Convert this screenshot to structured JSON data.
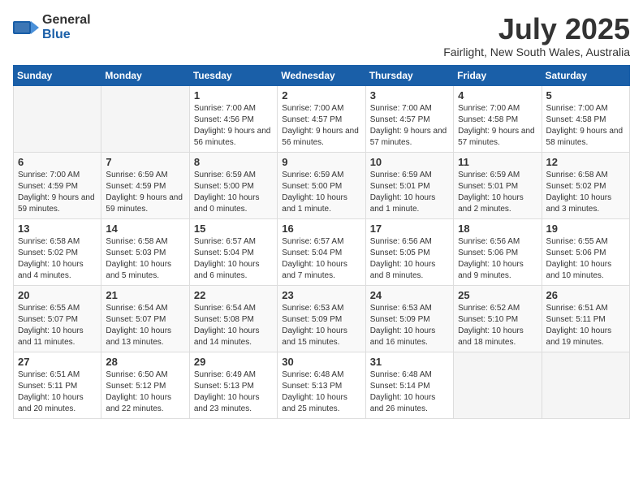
{
  "header": {
    "logo_general": "General",
    "logo_blue": "Blue",
    "month_title": "July 2025",
    "location": "Fairlight, New South Wales, Australia"
  },
  "days_of_week": [
    "Sunday",
    "Monday",
    "Tuesday",
    "Wednesday",
    "Thursday",
    "Friday",
    "Saturday"
  ],
  "weeks": [
    [
      {
        "day": "",
        "info": ""
      },
      {
        "day": "",
        "info": ""
      },
      {
        "day": "1",
        "info": "Sunrise: 7:00 AM\nSunset: 4:56 PM\nDaylight: 9 hours and 56 minutes."
      },
      {
        "day": "2",
        "info": "Sunrise: 7:00 AM\nSunset: 4:57 PM\nDaylight: 9 hours and 56 minutes."
      },
      {
        "day": "3",
        "info": "Sunrise: 7:00 AM\nSunset: 4:57 PM\nDaylight: 9 hours and 57 minutes."
      },
      {
        "day": "4",
        "info": "Sunrise: 7:00 AM\nSunset: 4:58 PM\nDaylight: 9 hours and 57 minutes."
      },
      {
        "day": "5",
        "info": "Sunrise: 7:00 AM\nSunset: 4:58 PM\nDaylight: 9 hours and 58 minutes."
      }
    ],
    [
      {
        "day": "6",
        "info": "Sunrise: 7:00 AM\nSunset: 4:59 PM\nDaylight: 9 hours and 59 minutes."
      },
      {
        "day": "7",
        "info": "Sunrise: 6:59 AM\nSunset: 4:59 PM\nDaylight: 9 hours and 59 minutes."
      },
      {
        "day": "8",
        "info": "Sunrise: 6:59 AM\nSunset: 5:00 PM\nDaylight: 10 hours and 0 minutes."
      },
      {
        "day": "9",
        "info": "Sunrise: 6:59 AM\nSunset: 5:00 PM\nDaylight: 10 hours and 1 minute."
      },
      {
        "day": "10",
        "info": "Sunrise: 6:59 AM\nSunset: 5:01 PM\nDaylight: 10 hours and 1 minute."
      },
      {
        "day": "11",
        "info": "Sunrise: 6:59 AM\nSunset: 5:01 PM\nDaylight: 10 hours and 2 minutes."
      },
      {
        "day": "12",
        "info": "Sunrise: 6:58 AM\nSunset: 5:02 PM\nDaylight: 10 hours and 3 minutes."
      }
    ],
    [
      {
        "day": "13",
        "info": "Sunrise: 6:58 AM\nSunset: 5:02 PM\nDaylight: 10 hours and 4 minutes."
      },
      {
        "day": "14",
        "info": "Sunrise: 6:58 AM\nSunset: 5:03 PM\nDaylight: 10 hours and 5 minutes."
      },
      {
        "day": "15",
        "info": "Sunrise: 6:57 AM\nSunset: 5:04 PM\nDaylight: 10 hours and 6 minutes."
      },
      {
        "day": "16",
        "info": "Sunrise: 6:57 AM\nSunset: 5:04 PM\nDaylight: 10 hours and 7 minutes."
      },
      {
        "day": "17",
        "info": "Sunrise: 6:56 AM\nSunset: 5:05 PM\nDaylight: 10 hours and 8 minutes."
      },
      {
        "day": "18",
        "info": "Sunrise: 6:56 AM\nSunset: 5:06 PM\nDaylight: 10 hours and 9 minutes."
      },
      {
        "day": "19",
        "info": "Sunrise: 6:55 AM\nSunset: 5:06 PM\nDaylight: 10 hours and 10 minutes."
      }
    ],
    [
      {
        "day": "20",
        "info": "Sunrise: 6:55 AM\nSunset: 5:07 PM\nDaylight: 10 hours and 11 minutes."
      },
      {
        "day": "21",
        "info": "Sunrise: 6:54 AM\nSunset: 5:07 PM\nDaylight: 10 hours and 13 minutes."
      },
      {
        "day": "22",
        "info": "Sunrise: 6:54 AM\nSunset: 5:08 PM\nDaylight: 10 hours and 14 minutes."
      },
      {
        "day": "23",
        "info": "Sunrise: 6:53 AM\nSunset: 5:09 PM\nDaylight: 10 hours and 15 minutes."
      },
      {
        "day": "24",
        "info": "Sunrise: 6:53 AM\nSunset: 5:09 PM\nDaylight: 10 hours and 16 minutes."
      },
      {
        "day": "25",
        "info": "Sunrise: 6:52 AM\nSunset: 5:10 PM\nDaylight: 10 hours and 18 minutes."
      },
      {
        "day": "26",
        "info": "Sunrise: 6:51 AM\nSunset: 5:11 PM\nDaylight: 10 hours and 19 minutes."
      }
    ],
    [
      {
        "day": "27",
        "info": "Sunrise: 6:51 AM\nSunset: 5:11 PM\nDaylight: 10 hours and 20 minutes."
      },
      {
        "day": "28",
        "info": "Sunrise: 6:50 AM\nSunset: 5:12 PM\nDaylight: 10 hours and 22 minutes."
      },
      {
        "day": "29",
        "info": "Sunrise: 6:49 AM\nSunset: 5:13 PM\nDaylight: 10 hours and 23 minutes."
      },
      {
        "day": "30",
        "info": "Sunrise: 6:48 AM\nSunset: 5:13 PM\nDaylight: 10 hours and 25 minutes."
      },
      {
        "day": "31",
        "info": "Sunrise: 6:48 AM\nSunset: 5:14 PM\nDaylight: 10 hours and 26 minutes."
      },
      {
        "day": "",
        "info": ""
      },
      {
        "day": "",
        "info": ""
      }
    ]
  ]
}
